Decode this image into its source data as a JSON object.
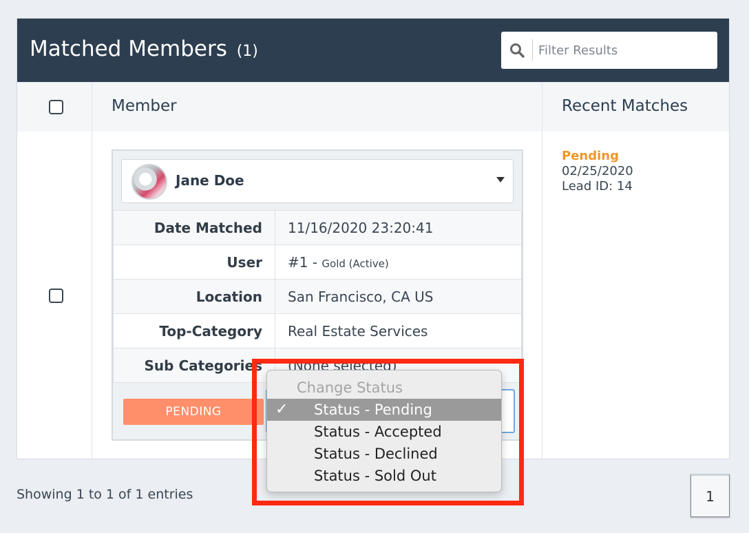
{
  "header": {
    "title": "Matched Members",
    "count": "(1)"
  },
  "filter": {
    "placeholder": "Filter Results",
    "icon": "search-icon"
  },
  "columns": {
    "member": "Member",
    "recent": "Recent Matches"
  },
  "member": {
    "name": "Jane Doe",
    "details": [
      {
        "label": "Date Matched",
        "value": "11/16/2020 23:20:41"
      },
      {
        "label": "User",
        "value": "#1 - ",
        "value_small": "Gold (Active)"
      },
      {
        "label": "Location",
        "value": "San Francisco, CA US"
      },
      {
        "label": "Top-Category",
        "value": "Real Estate Services"
      },
      {
        "label": "Sub Categories",
        "value": "(None selected)"
      }
    ],
    "status_button": "PENDING"
  },
  "recent_match": {
    "status": "Pending",
    "date": "02/25/2020",
    "lead": "Lead ID: 14"
  },
  "status_dropdown": {
    "header": "Change Status",
    "options": [
      "Status - Pending",
      "Status - Accepted",
      "Status - Declined",
      "Status - Sold Out"
    ],
    "selected_index": 0,
    "checkmark": "✓"
  },
  "footer": {
    "entries": "Showing 1 to 1 of 1 entries",
    "page": "1"
  },
  "colors": {
    "header_bg": "#2d3e50",
    "pending": "#f0962a",
    "pending_button": "#ff8f6b",
    "highlight": "#ff2a12"
  }
}
